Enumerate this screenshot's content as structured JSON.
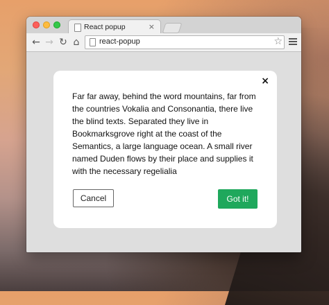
{
  "browser": {
    "tab": {
      "title": "React popup",
      "close_glyph": "×",
      "icon": "page-icon"
    },
    "toolbar": {
      "back_glyph": "←",
      "forward_glyph": "→",
      "reload_glyph": "↻",
      "home_glyph": "⌂",
      "url": "react-popup",
      "star_glyph": "☆"
    }
  },
  "popup": {
    "close_glyph": "×",
    "body_text": "Far far away, behind the word mountains, far from the countries Vokalia and Consonantia, there live the blind texts. Separated they live in Bookmarksgrove right at the coast of the Semantics, a large language ocean. A small river named Duden flows by their place and supplies it with the necessary regelialia",
    "cancel_label": "Cancel",
    "confirm_label": "Got it!",
    "confirm_color": "#1fa85c"
  }
}
